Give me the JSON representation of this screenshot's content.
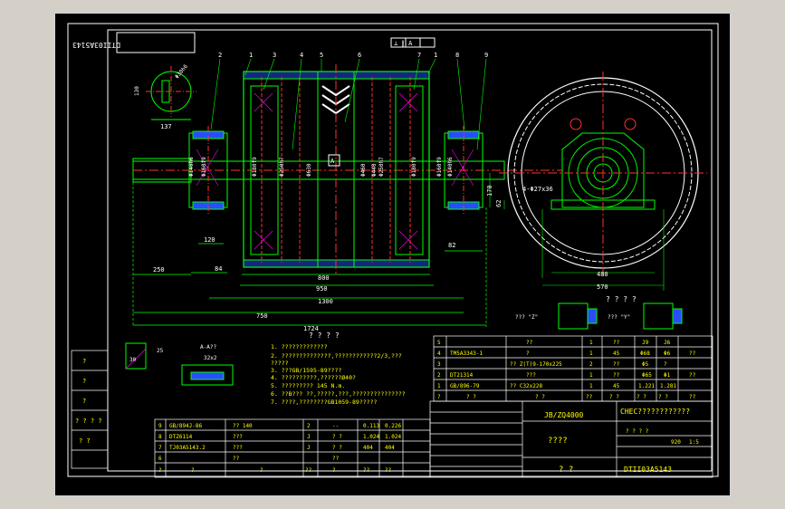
{
  "drawing": {
    "rotated_code": "DTII03A5143",
    "rotated_code_sub": "Z\nY",
    "part_callouts": [
      "2",
      "1",
      "3",
      "4",
      "5",
      "6",
      "7",
      "1",
      "8",
      "9"
    ],
    "center_label": "A",
    "top_flag": "⊥ ∥ A",
    "small_view": {
      "dim_130": "130",
      "dim_phi": "Φ30h6",
      "dim_137": "137"
    },
    "dims_inner": [
      "Φ140h6",
      "Φ160f9",
      "Φ180f9",
      "Φ250h7",
      "Φ630",
      "Φ460",
      "Φ440",
      "Φ250h7",
      "Φ180f9",
      "Φ160f9",
      "Φ140h6"
    ],
    "dims_bottom": {
      "d120": "120",
      "d84": "84",
      "d250": "250",
      "d800": "800",
      "d950": "950",
      "d1300": "1300",
      "d750": "750",
      "d1724": "1724",
      "d82": "82"
    },
    "side_dims": {
      "d170": "170",
      "d62": "62",
      "bolts": "4-Φ27x36",
      "d480": "480",
      "d570": "570"
    },
    "view_labels": {
      "views_title": "? ? ? ?",
      "view_z": "??? \"Z\"",
      "view_y": "??? \"Y\""
    },
    "detail": {
      "label_a": "A-A??",
      "dim_25": "25",
      "dim_30": "30",
      "dim_32": "32x2",
      "ratio": "1:1"
    },
    "notes_title": "? ? ? ?",
    "notes": [
      "1. ?????????????",
      "2. ??????????????,????????????2/3,???",
      "   ?????",
      "3. ???GB/1595-89????",
      "4. ??????????,??????Ø40?",
      "5. ????????? 145   N.m.",
      "6. ??B??? ??,?????,???,???????????????",
      "7. ????,????????GB1059-89?????"
    ]
  },
  "parts_table_upper": [
    [
      "5",
      "",
      "??",
      "1",
      "??",
      "J9",
      "J6"
    ],
    [
      "4",
      "TM5A3343-1",
      "?",
      "1",
      "45",
      "Φ68",
      "Φ6",
      "??"
    ],
    [
      "3",
      "",
      "?? Z(T)9-170x225",
      "2",
      "??",
      "Φ5",
      "?"
    ],
    [
      "2",
      "DT21314",
      "???",
      "1",
      "??",
      "Φ65",
      "Φ1",
      "??"
    ],
    [
      "1",
      "GB/896-79",
      "?? C32x228",
      "1",
      "45",
      "1.221",
      "1.281"
    ],
    [
      "?",
      "? ?",
      "? ?",
      "??",
      "? ?",
      "? ?",
      "? ?",
      "??"
    ]
  ],
  "parts_table_lower": [
    [
      "9",
      "GB/894J-86",
      "?? 140",
      "2",
      "--",
      "0.113",
      "0.226"
    ],
    [
      "8",
      "DTZ6114",
      "???",
      "J",
      "? ?",
      "1.024",
      "1.024"
    ],
    [
      "7",
      "TJ03A5143.2",
      "???",
      "J",
      "? ?",
      "404",
      "404"
    ],
    [
      "6",
      "",
      "??",
      "",
      "??",
      "",
      ""
    ],
    [
      "?",
      "?",
      "?",
      "??",
      "?",
      "??",
      "??"
    ]
  ],
  "title_block": {
    "standard": "JB/ZQ4000",
    "company": "CHEC????????????",
    "name": "????",
    "scale_label": "? ? ? ?",
    "weight": "920",
    "ratio": "1:5",
    "drawing_no": "DTII03A5143",
    "stamp": "? ?",
    "left_rows": [
      "?",
      "?",
      "?",
      "? ? ? ?",
      "? ?"
    ]
  },
  "colors": {
    "frame": "#ffffff",
    "geometry": "#00ff00",
    "dimension": "#00ff00",
    "centerline": "#ff3030",
    "hidden": "#ff00ff",
    "fill_blue": "#2a4cff",
    "text_yellow": "#ffff00",
    "text_white": "#ffffff"
  }
}
